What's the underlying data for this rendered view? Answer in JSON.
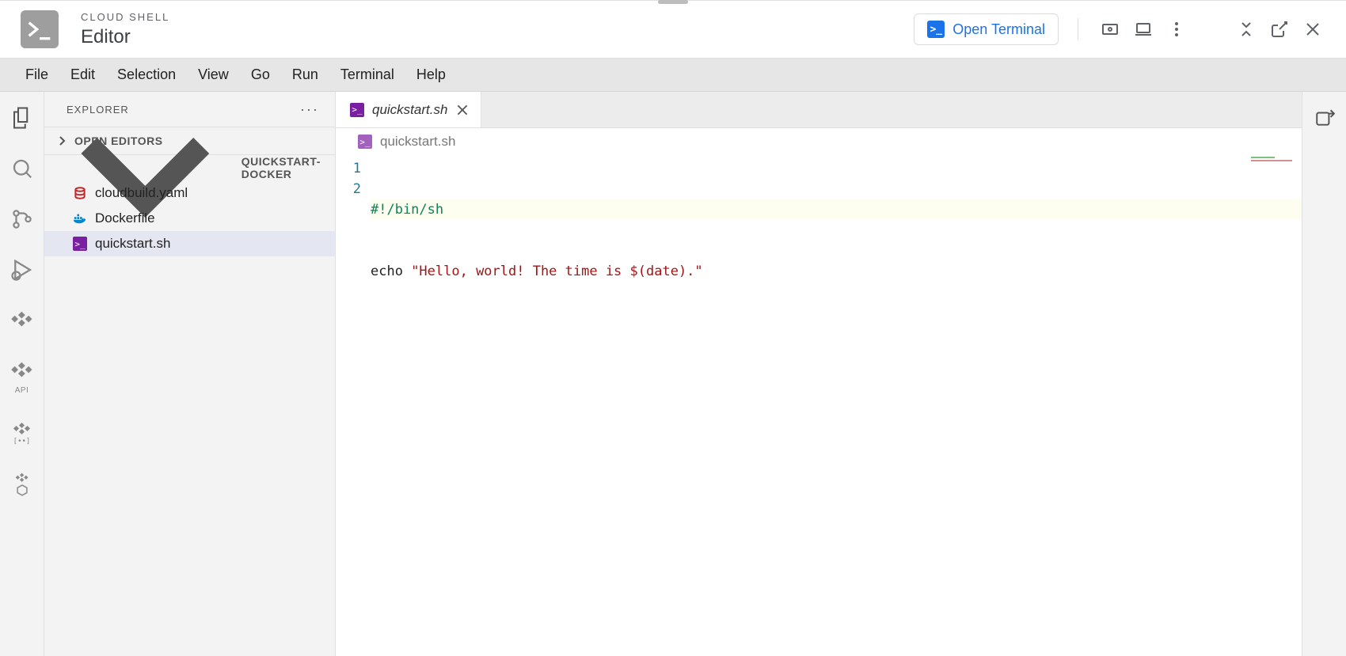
{
  "header": {
    "context": "CLOUD SHELL",
    "title": "Editor",
    "open_terminal_label": "Open Terminal"
  },
  "menubar": {
    "items": [
      "File",
      "Edit",
      "Selection",
      "View",
      "Go",
      "Run",
      "Terminal",
      "Help"
    ]
  },
  "activitybar": {
    "items": [
      {
        "name": "files-icon",
        "label": "Explorer"
      },
      {
        "name": "search-icon",
        "label": "Search"
      },
      {
        "name": "source-control-icon",
        "label": "Source Control"
      },
      {
        "name": "debug-icon",
        "label": "Run and Debug"
      },
      {
        "name": "cloud-code-icon",
        "label": "Cloud Code"
      },
      {
        "name": "cloud-apis-icon",
        "label": "Cloud APIs"
      },
      {
        "name": "secret-manager-icon",
        "label": "Secret Manager"
      },
      {
        "name": "kubernetes-icon",
        "label": "Kubernetes"
      }
    ],
    "api_caption": "API"
  },
  "explorer": {
    "panel_title": "EXPLORER",
    "sections": {
      "open_editors": "OPEN EDITORS",
      "folder": "QUICKSTART-DOCKER"
    },
    "files": [
      {
        "name": "cloudbuild.yaml",
        "icon": "yaml",
        "active": false
      },
      {
        "name": "Dockerfile",
        "icon": "docker",
        "active": false
      },
      {
        "name": "quickstart.sh",
        "icon": "sh",
        "active": true
      }
    ]
  },
  "editor": {
    "tab": {
      "name": "quickstart.sh",
      "modified_italic": true
    },
    "breadcrumb": "quickstart.sh",
    "line_numbers": [
      "1",
      "2"
    ],
    "code": {
      "line1": {
        "shebang": "#!/bin/sh"
      },
      "line2": {
        "cmd": "echo ",
        "string": "\"Hello, world! The time is $(date).\""
      }
    }
  }
}
